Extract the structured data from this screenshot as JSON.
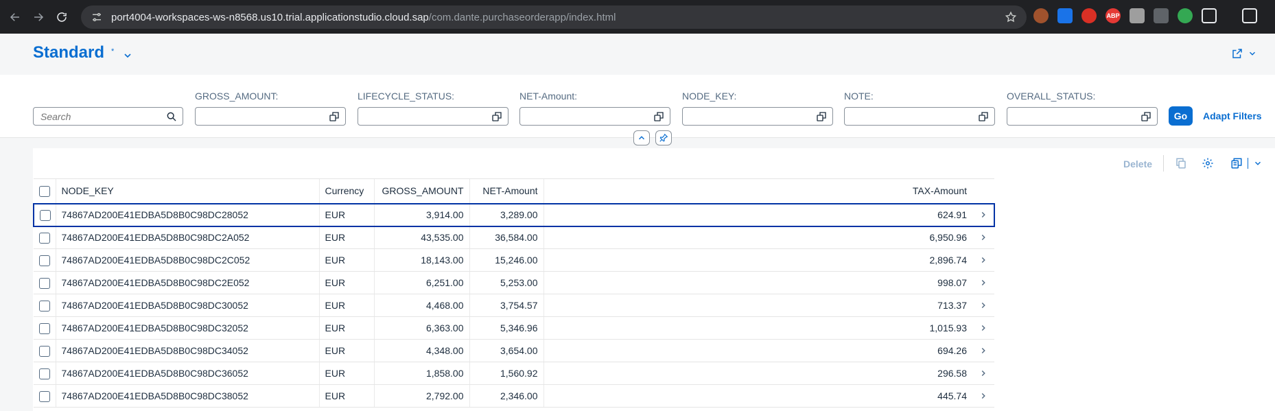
{
  "browser": {
    "url_host": "port4004-workspaces-ws-n8568.us10.trial.applicationstudio.cloud.sap",
    "url_path": "/com.dante.purchaseorderapp/index.html",
    "extensions": [
      "ext-1",
      "ext-2",
      "ext-3",
      "ABP",
      "ext-5",
      "ext-6",
      "ext-7"
    ]
  },
  "header": {
    "variant_title": "Standard",
    "variant_dirty_marker": "*"
  },
  "filters": {
    "search_placeholder": "Search",
    "fields": [
      {
        "label": "GROSS_AMOUNT:",
        "value": ""
      },
      {
        "label": "LIFECYCLE_STATUS:",
        "value": ""
      },
      {
        "label": "NET-Amount:",
        "value": ""
      },
      {
        "label": "NODE_KEY:",
        "value": ""
      },
      {
        "label": "NOTE:",
        "value": ""
      },
      {
        "label": "OVERALL_STATUS:",
        "value": ""
      }
    ],
    "go_label": "Go",
    "adapt_label": "Adapt Filters"
  },
  "toolbar": {
    "delete_label": "Delete"
  },
  "table": {
    "columns": [
      "NODE_KEY",
      "Currency",
      "GROSS_AMOUNT",
      "NET-Amount",
      "TAX-Amount"
    ],
    "rows": [
      {
        "node_key": "74867AD200E41EDBA5D8B0C98DC28052",
        "currency": "EUR",
        "gross": "3,914.00",
        "net": "3,289.00",
        "tax": "624.91"
      },
      {
        "node_key": "74867AD200E41EDBA5D8B0C98DC2A052",
        "currency": "EUR",
        "gross": "43,535.00",
        "net": "36,584.00",
        "tax": "6,950.96"
      },
      {
        "node_key": "74867AD200E41EDBA5D8B0C98DC2C052",
        "currency": "EUR",
        "gross": "18,143.00",
        "net": "15,246.00",
        "tax": "2,896.74"
      },
      {
        "node_key": "74867AD200E41EDBA5D8B0C98DC2E052",
        "currency": "EUR",
        "gross": "6,251.00",
        "net": "5,253.00",
        "tax": "998.07"
      },
      {
        "node_key": "74867AD200E41EDBA5D8B0C98DC30052",
        "currency": "EUR",
        "gross": "4,468.00",
        "net": "3,754.57",
        "tax": "713.37"
      },
      {
        "node_key": "74867AD200E41EDBA5D8B0C98DC32052",
        "currency": "EUR",
        "gross": "6,363.00",
        "net": "5,346.96",
        "tax": "1,015.93"
      },
      {
        "node_key": "74867AD200E41EDBA5D8B0C98DC34052",
        "currency": "EUR",
        "gross": "4,348.00",
        "net": "3,654.00",
        "tax": "694.26"
      },
      {
        "node_key": "74867AD200E41EDBA5D8B0C98DC36052",
        "currency": "EUR",
        "gross": "1,858.00",
        "net": "1,560.92",
        "tax": "296.58"
      },
      {
        "node_key": "74867AD200E41EDBA5D8B0C98DC38052",
        "currency": "EUR",
        "gross": "2,792.00",
        "net": "2,346.00",
        "tax": "445.74"
      }
    ]
  },
  "colors": {
    "accent": "#0a6ed1",
    "focus_border": "#0032a5",
    "chrome_bg": "#202124"
  }
}
